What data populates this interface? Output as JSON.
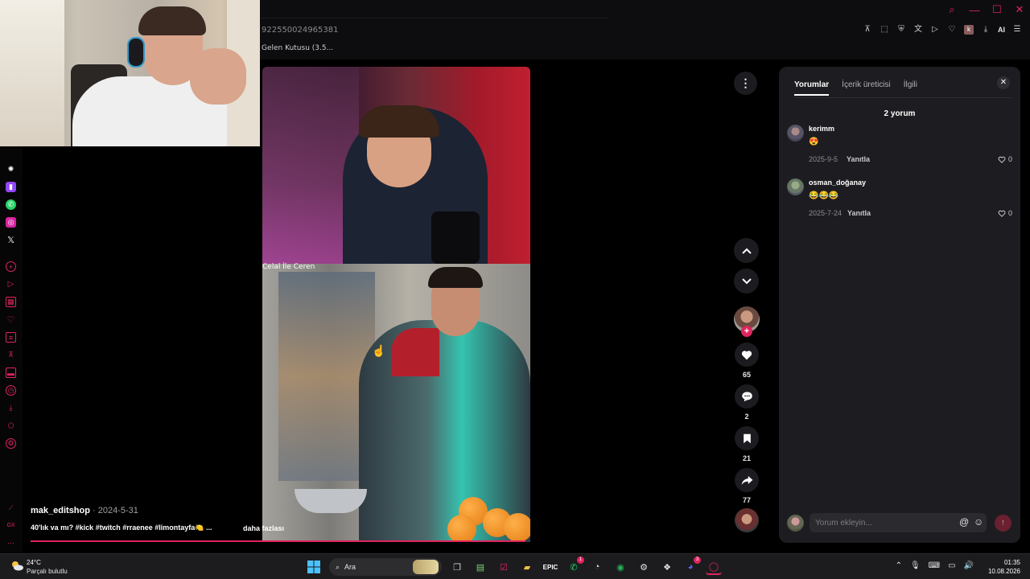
{
  "browser": {
    "url_fragment": "922550024965381",
    "bookmark": "Gelen Kutusu (3.5...",
    "ai_label": "AI",
    "profile_initial": "k"
  },
  "video": {
    "title_overlay": "Celal İle Ceren",
    "author": "mak_editshop",
    "date": " · 2024-5-31",
    "caption": "40'lık va mı? #kick #twitch #rraenee #limontayfa🍋 ...",
    "more_label": "daha fazlası",
    "progress": 0.99
  },
  "actions": {
    "likes": "65",
    "comments": "2",
    "saves": "21",
    "shares": "77"
  },
  "panel": {
    "tabs": [
      "Yorumlar",
      "İçerik üreticisi",
      "İlgili"
    ],
    "count_label": "2 yorum",
    "comments": [
      {
        "user": "kerimm",
        "text": "😍",
        "date": "2025-9-5",
        "reply": "Yanıtla",
        "likes": "0"
      },
      {
        "user": "osman_doğanay",
        "text": "😂😂😂",
        "date": "2025-7-24",
        "reply": "Yanıtla",
        "likes": "0"
      }
    ],
    "input_placeholder": "Yorum ekleyin..."
  },
  "taskbar": {
    "temperature": "24°C",
    "condition": "Parçalı bulutlu",
    "search_label": "Ara",
    "time": "01:35",
    "date": "10.08.2026",
    "badges": {
      "whatsapp": "1",
      "discord": "3"
    }
  },
  "colors": {
    "accent": "#e0245e",
    "panel_bg": "#1d1d21",
    "page_bg": "#000000"
  }
}
